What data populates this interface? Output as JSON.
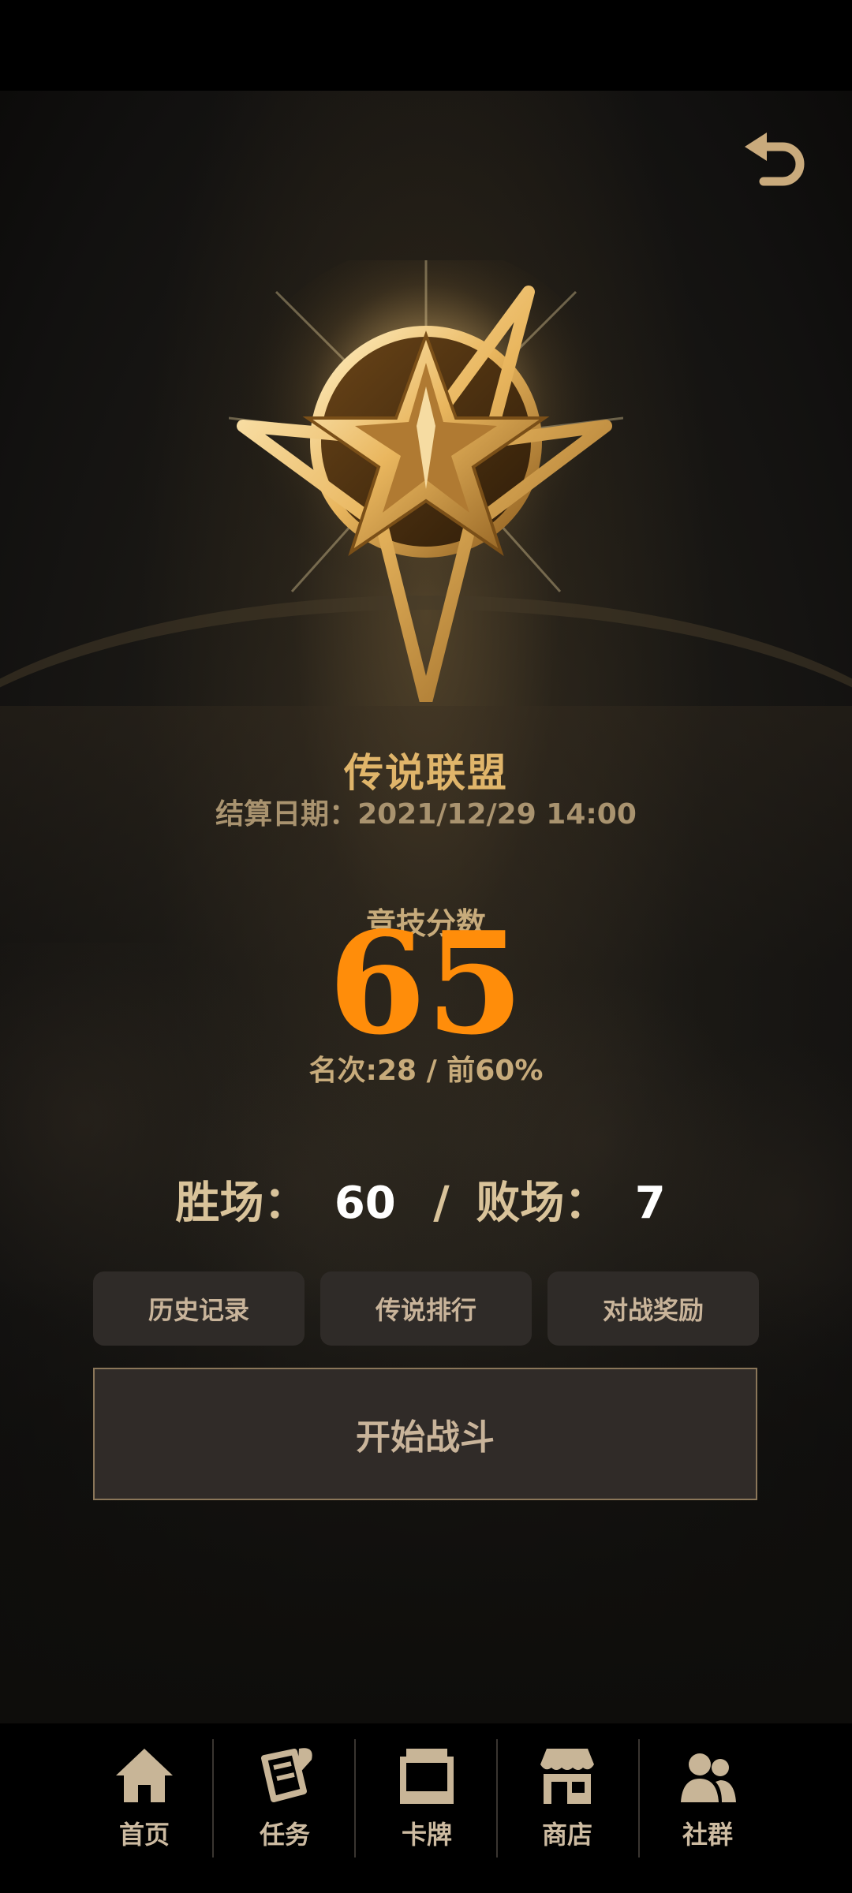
{
  "colors": {
    "accent_gold": "#e0b56a",
    "score_orange": "#ff8d0a",
    "button_bg": "#2f2b28",
    "button_text": "#c9b49a"
  },
  "header": {
    "back_icon": "back-arrow-icon"
  },
  "rank": {
    "emblem_icon": "gold-pentagram-rank-emblem",
    "title": "传说联盟",
    "settlement_date": "结算日期：2021/12/29 14:00"
  },
  "score": {
    "label": "竞技分数",
    "value": "65",
    "rank_text": "名次:28 / 前60%"
  },
  "record": {
    "wins_label": "胜场：",
    "wins": "60",
    "separator": "/",
    "losses_label": "败场：",
    "losses": "7"
  },
  "actions": {
    "history": "历史记录",
    "ranking": "传说排行",
    "rewards": "对战奖励",
    "start_battle": "开始战斗"
  },
  "tabs": [
    {
      "label": "首页",
      "icon": "home-icon"
    },
    {
      "label": "任务",
      "icon": "quest-scroll-icon"
    },
    {
      "label": "卡牌",
      "icon": "card-stack-icon"
    },
    {
      "label": "商店",
      "icon": "store-icon"
    },
    {
      "label": "社群",
      "icon": "community-icon"
    }
  ]
}
